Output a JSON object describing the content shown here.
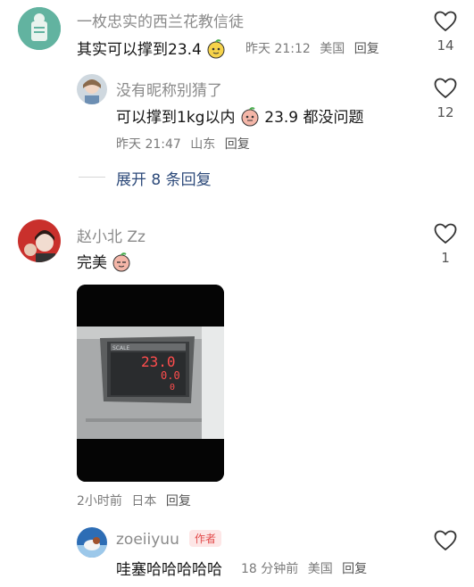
{
  "comments": [
    {
      "username": "一枚忠实的西兰花教信徒",
      "text": "其实可以撑到23.4",
      "time": "昨天 21:12",
      "location": "美国",
      "reply_label": "回复",
      "like_count": "14"
    },
    {
      "username": "没有昵称别猜了",
      "text_before": "可以撑到1kg以内",
      "text_after": "23.9 都没问题",
      "time": "昨天 21:47",
      "location": "山东",
      "reply_label": "回复",
      "like_count": "12"
    },
    {
      "username": "赵小北 Zz",
      "text": "完美",
      "time": "2小时前",
      "location": "日本",
      "reply_label": "回复",
      "like_count": "1",
      "photo": {
        "line1": "23.0",
        "line2": "0.0",
        "line3": "0",
        "brand": "SCALE"
      }
    },
    {
      "username": "zoeiiyuu",
      "badge": "作者",
      "text": "哇塞哈哈哈哈哈",
      "time": "18 分钟前",
      "location": "美国",
      "reply_label": "回复"
    }
  ],
  "expand": {
    "label": "展开 8 条回复"
  },
  "icons": {
    "like": "heart-outline-icon",
    "emoji": "peach-face-emoji-icon"
  },
  "colors": {
    "accent_link": "#2d4a7a",
    "badge_bg": "#fde6e6",
    "badge_text": "#e24b4b"
  }
}
